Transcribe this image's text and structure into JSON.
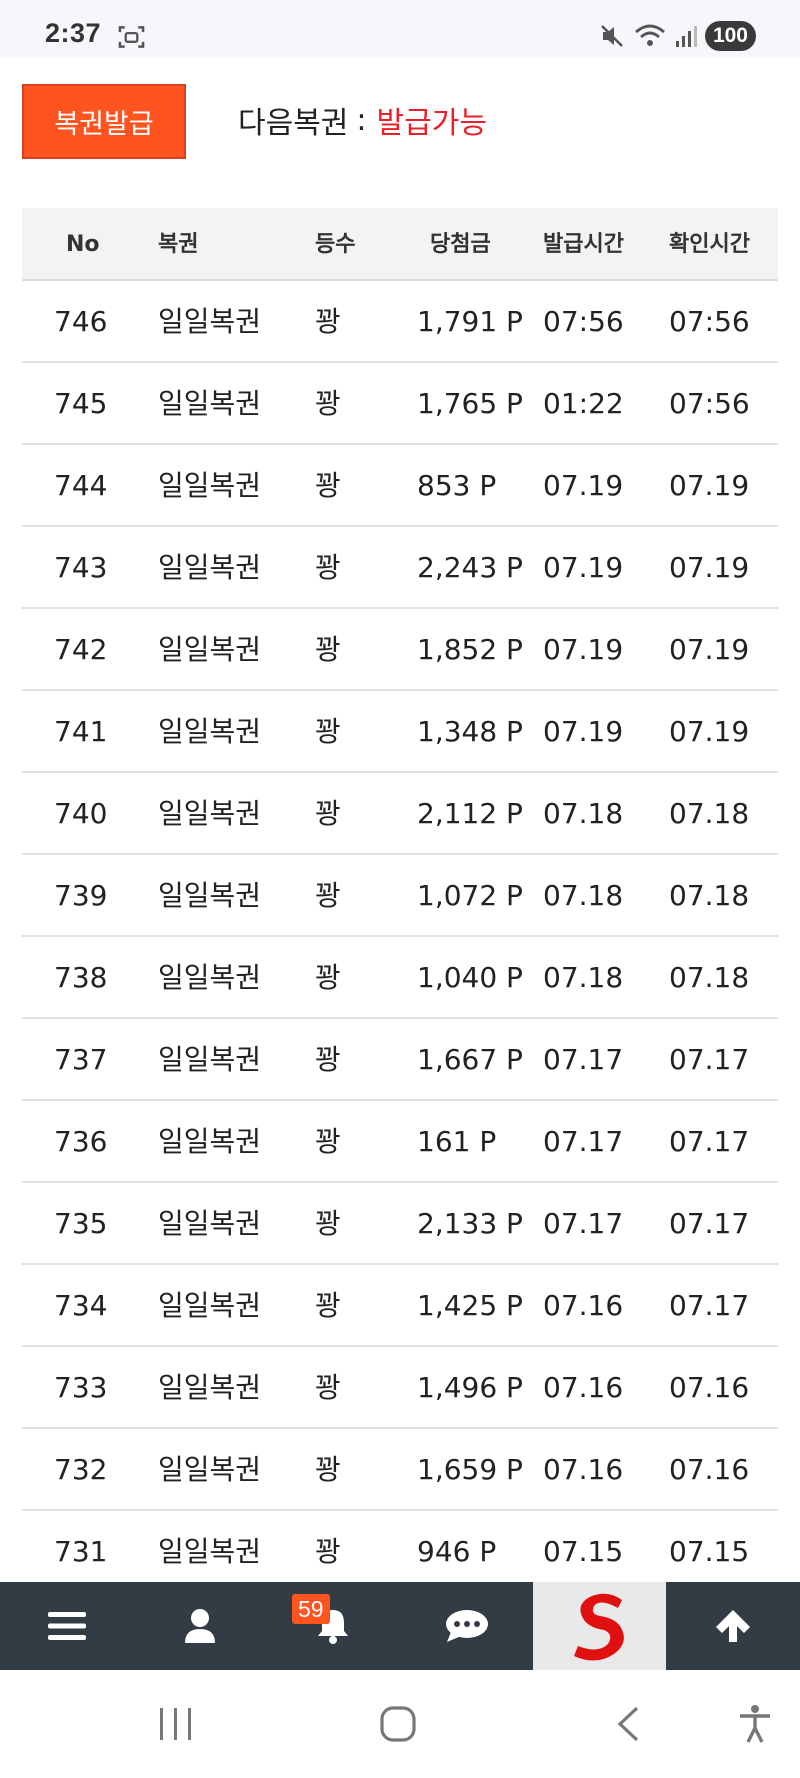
{
  "status_bar": {
    "time": "2:37",
    "battery": "100"
  },
  "header": {
    "issue_button_label": "복권발급",
    "next_ticket_label": "다음복권",
    "next_ticket_colon": ":",
    "next_ticket_value": "발급가능",
    "accent_color": "#ff5320",
    "value_color": "#e8202a"
  },
  "table": {
    "columns": [
      "No",
      "복권",
      "등수",
      "당첨금",
      "발급시간",
      "확인시간"
    ],
    "rows": [
      {
        "no": "746",
        "ticket": "일일복권",
        "rank": "꽝",
        "prize": "1,791 P",
        "issued": "07:56",
        "checked": "07:56"
      },
      {
        "no": "745",
        "ticket": "일일복권",
        "rank": "꽝",
        "prize": "1,765 P",
        "issued": "01:22",
        "checked": "07:56"
      },
      {
        "no": "744",
        "ticket": "일일복권",
        "rank": "꽝",
        "prize": "853 P",
        "issued": "07.19",
        "checked": "07.19"
      },
      {
        "no": "743",
        "ticket": "일일복권",
        "rank": "꽝",
        "prize": "2,243 P",
        "issued": "07.19",
        "checked": "07.19"
      },
      {
        "no": "742",
        "ticket": "일일복권",
        "rank": "꽝",
        "prize": "1,852 P",
        "issued": "07.19",
        "checked": "07.19"
      },
      {
        "no": "741",
        "ticket": "일일복권",
        "rank": "꽝",
        "prize": "1,348 P",
        "issued": "07.19",
        "checked": "07.19"
      },
      {
        "no": "740",
        "ticket": "일일복권",
        "rank": "꽝",
        "prize": "2,112 P",
        "issued": "07.18",
        "checked": "07.18"
      },
      {
        "no": "739",
        "ticket": "일일복권",
        "rank": "꽝",
        "prize": "1,072 P",
        "issued": "07.18",
        "checked": "07.18"
      },
      {
        "no": "738",
        "ticket": "일일복권",
        "rank": "꽝",
        "prize": "1,040 P",
        "issued": "07.18",
        "checked": "07.18"
      },
      {
        "no": "737",
        "ticket": "일일복권",
        "rank": "꽝",
        "prize": "1,667 P",
        "issued": "07.17",
        "checked": "07.17"
      },
      {
        "no": "736",
        "ticket": "일일복권",
        "rank": "꽝",
        "prize": "161 P",
        "issued": "07.17",
        "checked": "07.17"
      },
      {
        "no": "735",
        "ticket": "일일복권",
        "rank": "꽝",
        "prize": "2,133 P",
        "issued": "07.17",
        "checked": "07.17"
      },
      {
        "no": "734",
        "ticket": "일일복권",
        "rank": "꽝",
        "prize": "1,425 P",
        "issued": "07.16",
        "checked": "07.17"
      },
      {
        "no": "733",
        "ticket": "일일복권",
        "rank": "꽝",
        "prize": "1,496 P",
        "issued": "07.16",
        "checked": "07.16"
      },
      {
        "no": "732",
        "ticket": "일일복권",
        "rank": "꽝",
        "prize": "1,659 P",
        "issued": "07.16",
        "checked": "07.16"
      },
      {
        "no": "731",
        "ticket": "일일복권",
        "rank": "꽝",
        "prize": "946 P",
        "issued": "07.15",
        "checked": "07.15"
      }
    ]
  },
  "bottom_nav": {
    "items": [
      {
        "icon": "menu-icon"
      },
      {
        "icon": "user-icon"
      },
      {
        "icon": "bell-icon",
        "badge": "59"
      },
      {
        "icon": "chat-icon"
      },
      {
        "icon": "site-logo"
      },
      {
        "icon": "arrow-up-icon"
      }
    ],
    "background": "#333b44"
  },
  "system_nav": {
    "buttons": [
      "recent-apps-icon",
      "home-icon",
      "back-icon",
      "accessibility-icon"
    ]
  }
}
